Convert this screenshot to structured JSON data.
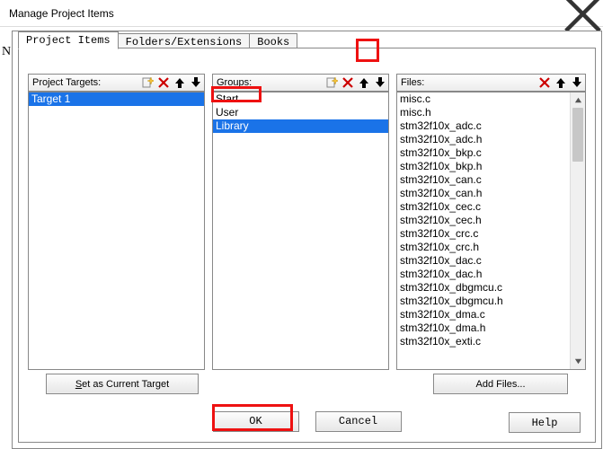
{
  "title": "Manage Project Items",
  "left_char": "N",
  "tabs": [
    "Project Items",
    "Folders/Extensions",
    "Books"
  ],
  "columns": {
    "targets_label": "Project Targets:",
    "groups_label": "Groups:",
    "files_label": "Files:"
  },
  "targets": [
    "Target 1"
  ],
  "groups": [
    "Start",
    "User",
    "Library"
  ],
  "files": [
    "misc.c",
    "misc.h",
    "stm32f10x_adc.c",
    "stm32f10x_adc.h",
    "stm32f10x_bkp.c",
    "stm32f10x_bkp.h",
    "stm32f10x_can.c",
    "stm32f10x_can.h",
    "stm32f10x_cec.c",
    "stm32f10x_cec.h",
    "stm32f10x_crc.c",
    "stm32f10x_crc.h",
    "stm32f10x_dac.c",
    "stm32f10x_dac.h",
    "stm32f10x_dbgmcu.c",
    "stm32f10x_dbgmcu.h",
    "stm32f10x_dma.c",
    "stm32f10x_dma.h",
    "stm32f10x_exti.c"
  ],
  "buttons": {
    "set_target": "Set as Current Target",
    "add_files": "Add Files...",
    "ok": "OK",
    "cancel": "Cancel",
    "help": "Help"
  }
}
